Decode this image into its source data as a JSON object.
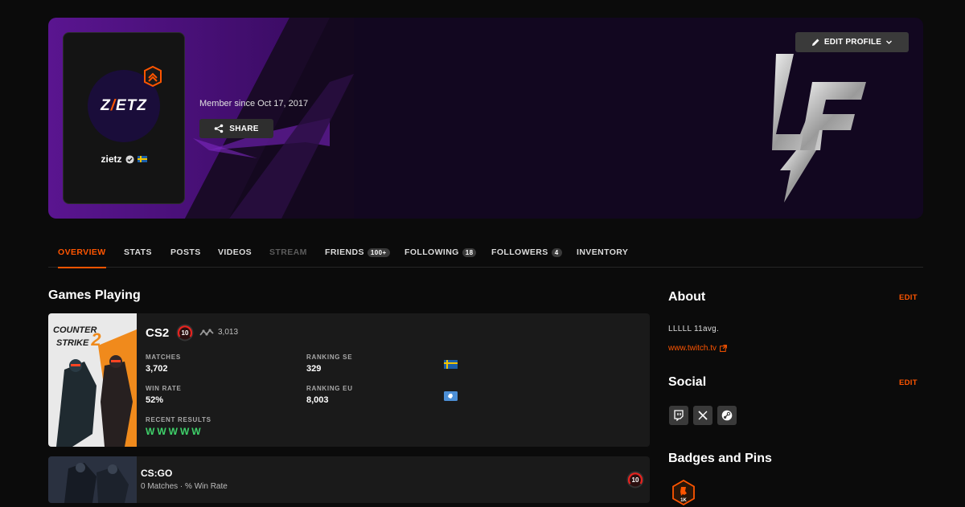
{
  "profile": {
    "avatar_text_left": "Z",
    "avatar_text_dash": "/",
    "avatar_text_right": "ETZ",
    "username": "zietz",
    "member_since": "Member since Oct 17, 2017",
    "share_label": "SHARE",
    "edit_profile_label": "EDIT PROFILE",
    "accent": "#ff5500"
  },
  "tabs": [
    {
      "label": "OVERVIEW",
      "active": true
    },
    {
      "label": "STATS"
    },
    {
      "label": "POSTS"
    },
    {
      "label": "VIDEOS"
    },
    {
      "label": "STREAM",
      "disabled": true
    },
    {
      "label": "FRIENDS",
      "count": "100+"
    },
    {
      "label": "FOLLOWING",
      "count": "18"
    },
    {
      "label": "FOLLOWERS",
      "count": "4"
    },
    {
      "label": "INVENTORY"
    }
  ],
  "games": {
    "title": "Games Playing",
    "cs2": {
      "cover_line1": "COUNTER",
      "cover_line2": "STRIKE",
      "cover_num": "2",
      "name": "CS2",
      "level": "10",
      "elo": "3,013",
      "matches_label": "MATCHES",
      "matches": "3,702",
      "ranking_se_label": "RANKING SE",
      "ranking_se": "329",
      "win_rate_label": "WIN RATE",
      "win_rate": "52%",
      "ranking_eu_label": "RANKING EU",
      "ranking_eu": "8,003",
      "recent_label": "RECENT RESULTS",
      "recent_results": "WWWWW"
    },
    "csgo": {
      "name": "CS:GO",
      "subtitle": "0 Matches · % Win Rate",
      "level": "10"
    }
  },
  "about": {
    "title": "About",
    "edit_label": "EDIT",
    "text": "LLLLL 11avg.",
    "link": "www.twitch.tv"
  },
  "social": {
    "title": "Social",
    "edit_label": "EDIT",
    "icons": [
      "twitch-icon",
      "x-icon",
      "steam-icon"
    ]
  },
  "badges": {
    "title": "Badges and Pins",
    "pin_label": "1K"
  }
}
